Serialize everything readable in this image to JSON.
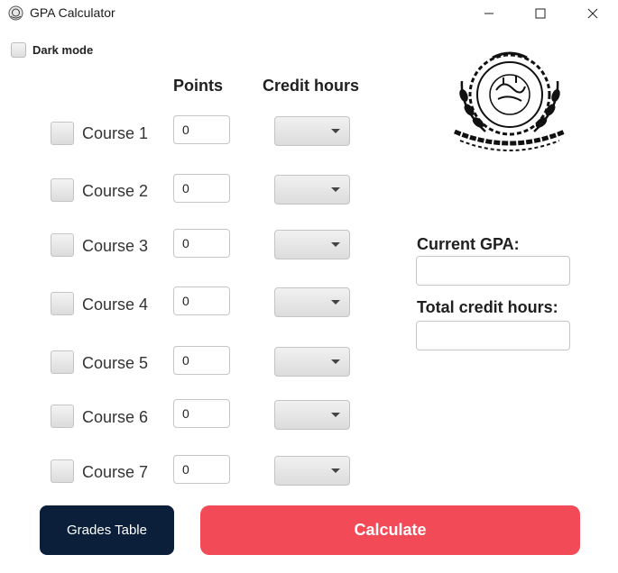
{
  "window": {
    "title": "GPA Calculator",
    "controls": [
      "minimize-icon",
      "maximize-icon",
      "close-icon"
    ]
  },
  "dark_mode": {
    "label": "Dark mode",
    "checked": false
  },
  "columns": {
    "points": "Points",
    "credit_hours": "Credit hours"
  },
  "courses": [
    {
      "label": "Course 1",
      "points": "0",
      "credit_hours": "",
      "checked": false
    },
    {
      "label": "Course 2",
      "points": "0",
      "credit_hours": "",
      "checked": false
    },
    {
      "label": "Course 3",
      "points": "0",
      "credit_hours": "",
      "checked": false
    },
    {
      "label": "Course 4",
      "points": "0",
      "credit_hours": "",
      "checked": false
    },
    {
      "label": "Course 5",
      "points": "0",
      "credit_hours": "",
      "checked": false
    },
    {
      "label": "Course 6",
      "points": "0",
      "credit_hours": "",
      "checked": false
    },
    {
      "label": "Course 7",
      "points": "0",
      "credit_hours": "",
      "checked": false
    }
  ],
  "results": {
    "current_gpa_label": "Current GPA:",
    "current_gpa_value": "",
    "total_credit_hours_label": "Total credit hours:",
    "total_credit_hours_value": ""
  },
  "buttons": {
    "grades_table": "Grades Table",
    "calculate": "Calculate"
  },
  "logo": {
    "icon": "university-emblem-icon"
  },
  "colors": {
    "grades_table_bg": "#0b1f3a",
    "calculate_bg": "#f34a57",
    "text": "#202020"
  }
}
